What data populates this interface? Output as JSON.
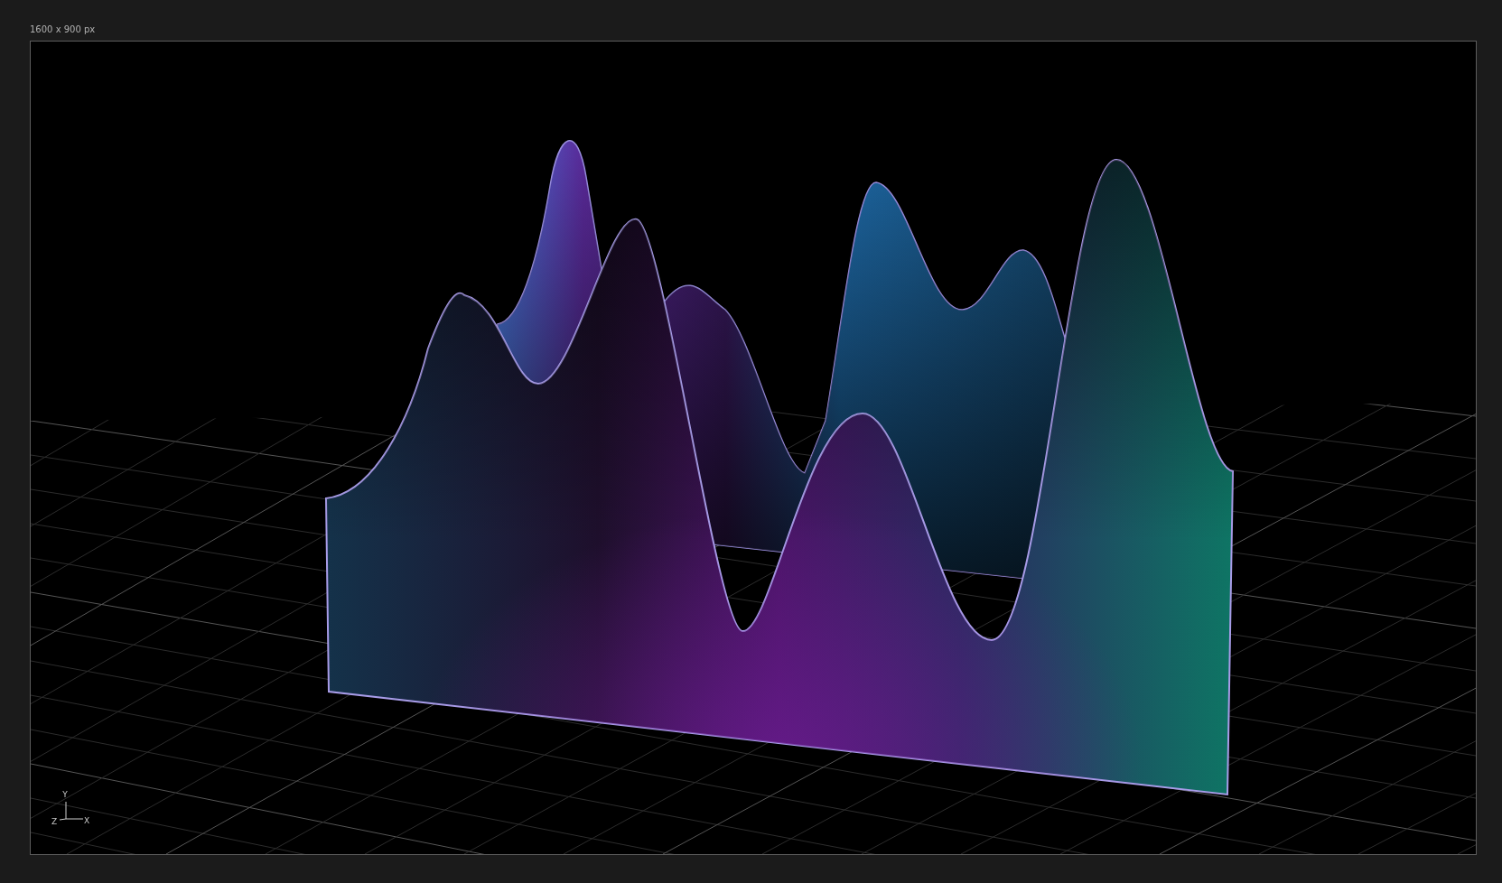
{
  "canvas": {
    "size_label": "1600 x 900 px"
  },
  "axis_gizmo": {
    "labels": [
      "Y",
      "Z",
      "X"
    ]
  }
}
